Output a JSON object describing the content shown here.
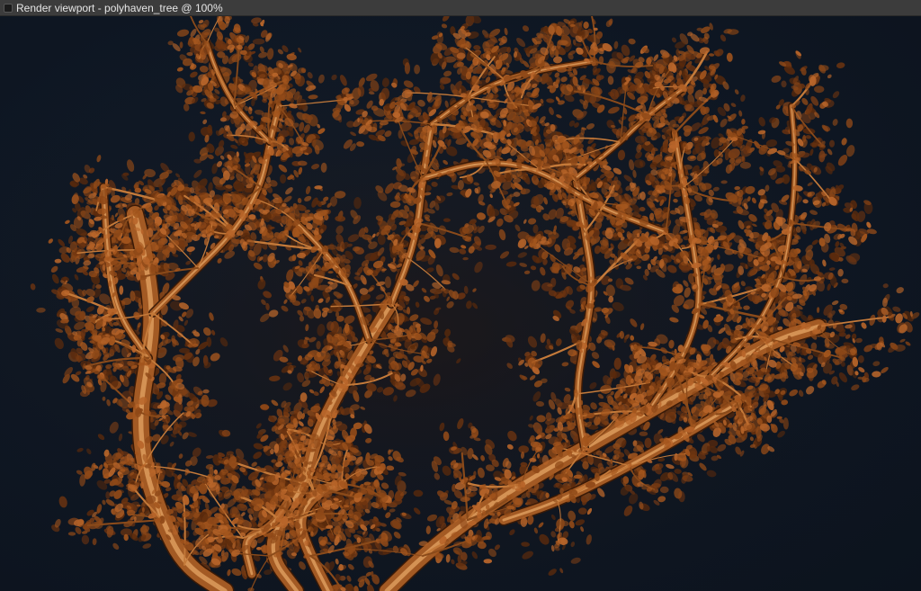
{
  "window": {
    "title": "Render viewport - polyhaven_tree @ 100%",
    "icon": "window-icon"
  },
  "viewport": {
    "background_color": "#0f1723",
    "subject_color": "#b0581c",
    "highlight_color": "#e08a3c"
  }
}
